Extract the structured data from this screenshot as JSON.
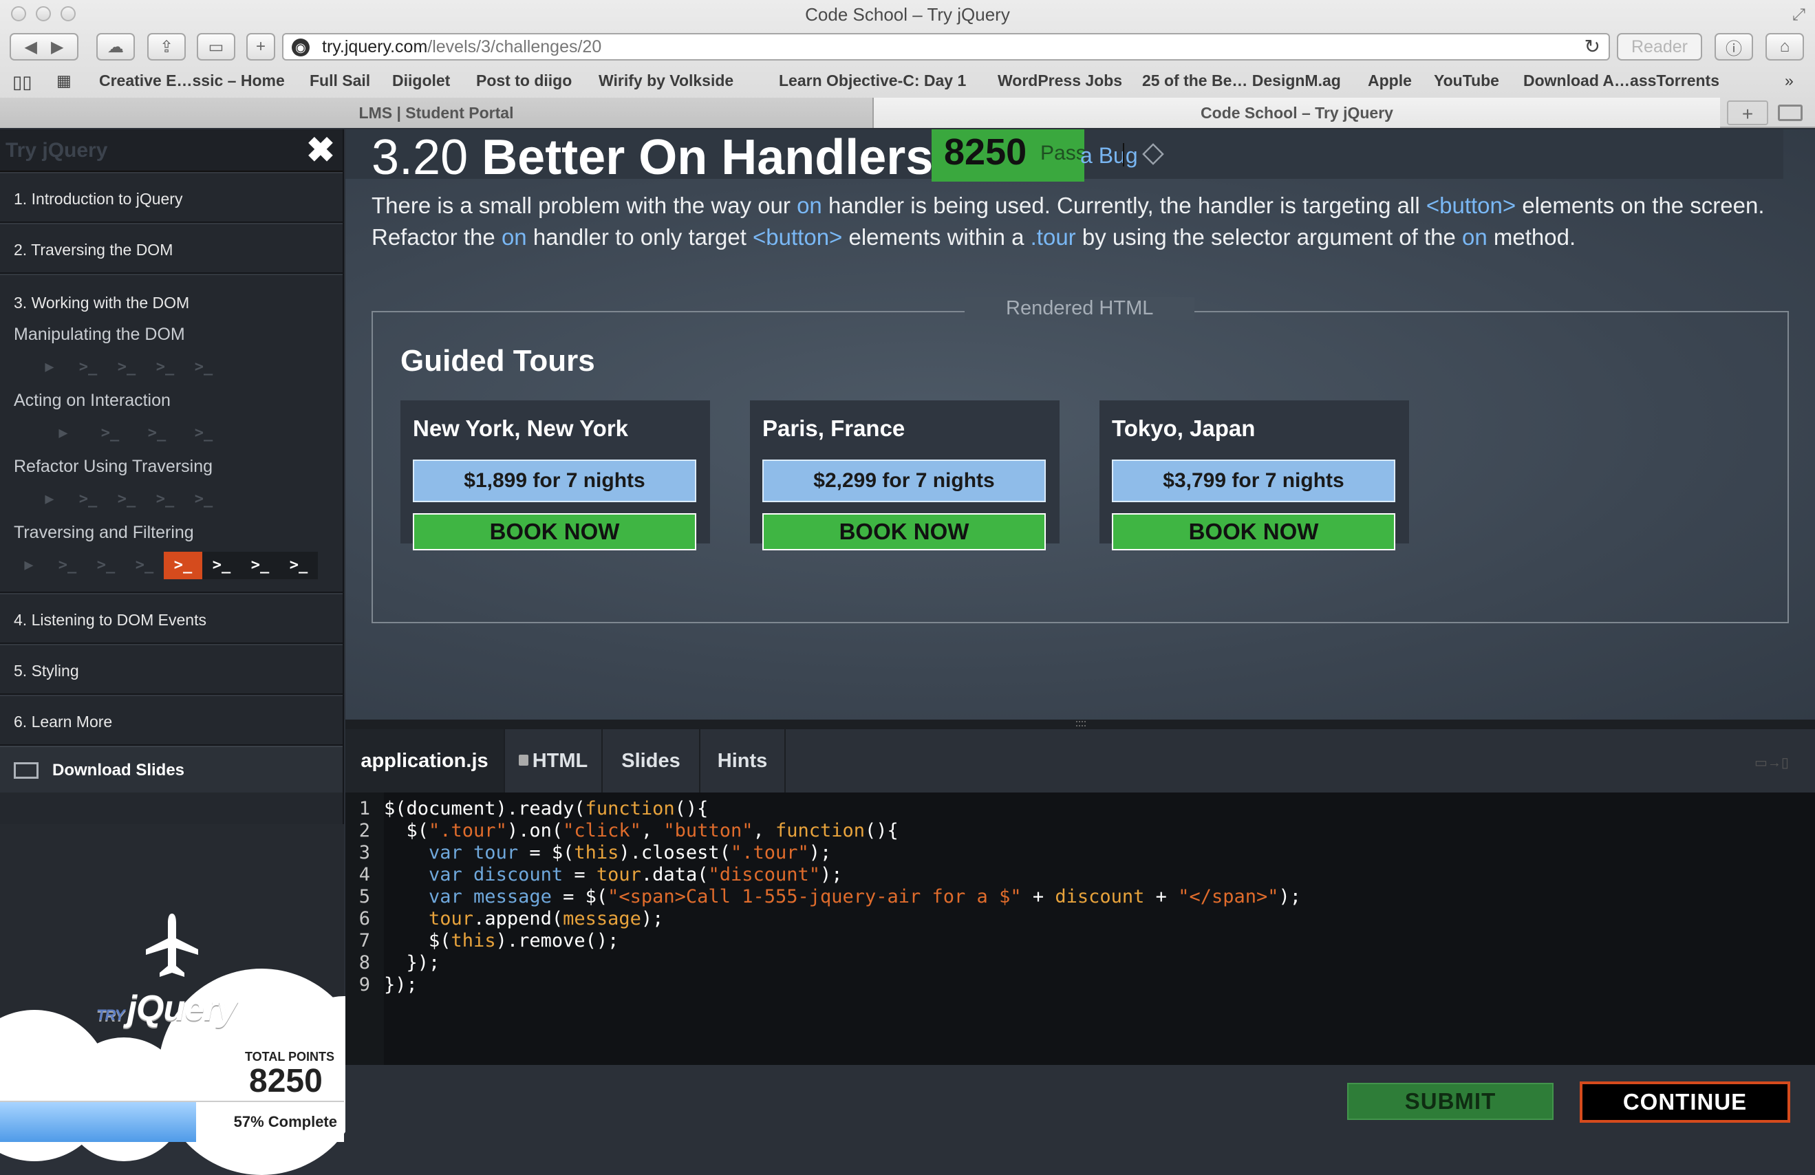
{
  "window": {
    "title": "Code School – Try jQuery"
  },
  "toolbar": {
    "url_host": "try.jquery.com",
    "url_path": "/levels/3/challenges/20",
    "reader_label": "Reader"
  },
  "bookmarks": [
    "Creative E…ssic – Home",
    "Full Sail",
    "Diigolet",
    "Post to diigo",
    "Wirify by Volkside",
    "Learn Objective-C: Day 1",
    "WordPress Jobs",
    "25 of the Be… DesignM.ag",
    "Apple",
    "YouTube",
    "Download A…assTorrents"
  ],
  "tabs": [
    {
      "label": "LMS | Student Portal",
      "active": false
    },
    {
      "label": "Code School – Try jQuery",
      "active": true
    }
  ],
  "sidebar": {
    "brand": "Try jQuery",
    "levels": [
      {
        "label": "1. Introduction to jQuery"
      },
      {
        "label": "2. Traversing the DOM"
      },
      {
        "label": "3. Working with the DOM"
      },
      {
        "label": "4. Listening to DOM Events"
      },
      {
        "label": "5. Styling"
      },
      {
        "label": "6. Learn More"
      }
    ],
    "sections": [
      {
        "title": "Manipulating the DOM"
      },
      {
        "title": "Acting on Interaction"
      },
      {
        "title": "Refactor Using Traversing"
      },
      {
        "title": "Traversing and Filtering"
      }
    ],
    "download_label": "Download Slides",
    "logo_text": "jQuery",
    "logo_prefix": "TRY",
    "points_label": "TOTAL POINTS",
    "points_value": "8250",
    "progress_label": "57% Complete",
    "progress_fraction": 0.57
  },
  "challenge": {
    "number": "3.20",
    "title": "Better On Handlers",
    "score": "8250",
    "score_status": "Pass",
    "bug_label": "a Bug",
    "desc_1a": "There is a small problem with the way our ",
    "desc_1b": "on",
    "desc_1c": " handler is being used. Currently, the handler is targeting all ",
    "desc_1d": "<button>",
    "desc_1e": " elements on the screen.",
    "desc_2a": "Refactor the ",
    "desc_2b": "on",
    "desc_2c": " handler to only target ",
    "desc_2d": "<button>",
    "desc_2e": " elements within a ",
    "desc_2f": ".tour",
    "desc_2g": " by using the selector argument of the ",
    "desc_2h": "on",
    "desc_2i": " method."
  },
  "rendered": {
    "label": "Rendered HTML",
    "heading": "Guided Tours",
    "tours": [
      {
        "city": "New York, New York",
        "price": "$1,899 for 7 nights",
        "book": "BOOK NOW"
      },
      {
        "city": "Paris, France",
        "price": "$2,299 for 7 nights",
        "book": "BOOK NOW"
      },
      {
        "city": "Tokyo, Japan",
        "price": "$3,799 for 7 nights",
        "book": "BOOK NOW"
      }
    ]
  },
  "editor": {
    "tabs": [
      "application.js",
      "HTML",
      "Slides",
      "Hints"
    ],
    "line_numbers": [
      "1",
      "2",
      "3",
      "4",
      "5",
      "6",
      "7",
      "8",
      "9"
    ]
  },
  "actions": {
    "submit": "SUBMIT",
    "continue": "CONTINUE"
  },
  "colors": {
    "accent_orange": "#d54b1d",
    "pass_green": "#3aa83e",
    "book_green": "#3fb543",
    "price_blue": "#8fbce9",
    "keyword_blue": "#7ab8f5"
  }
}
